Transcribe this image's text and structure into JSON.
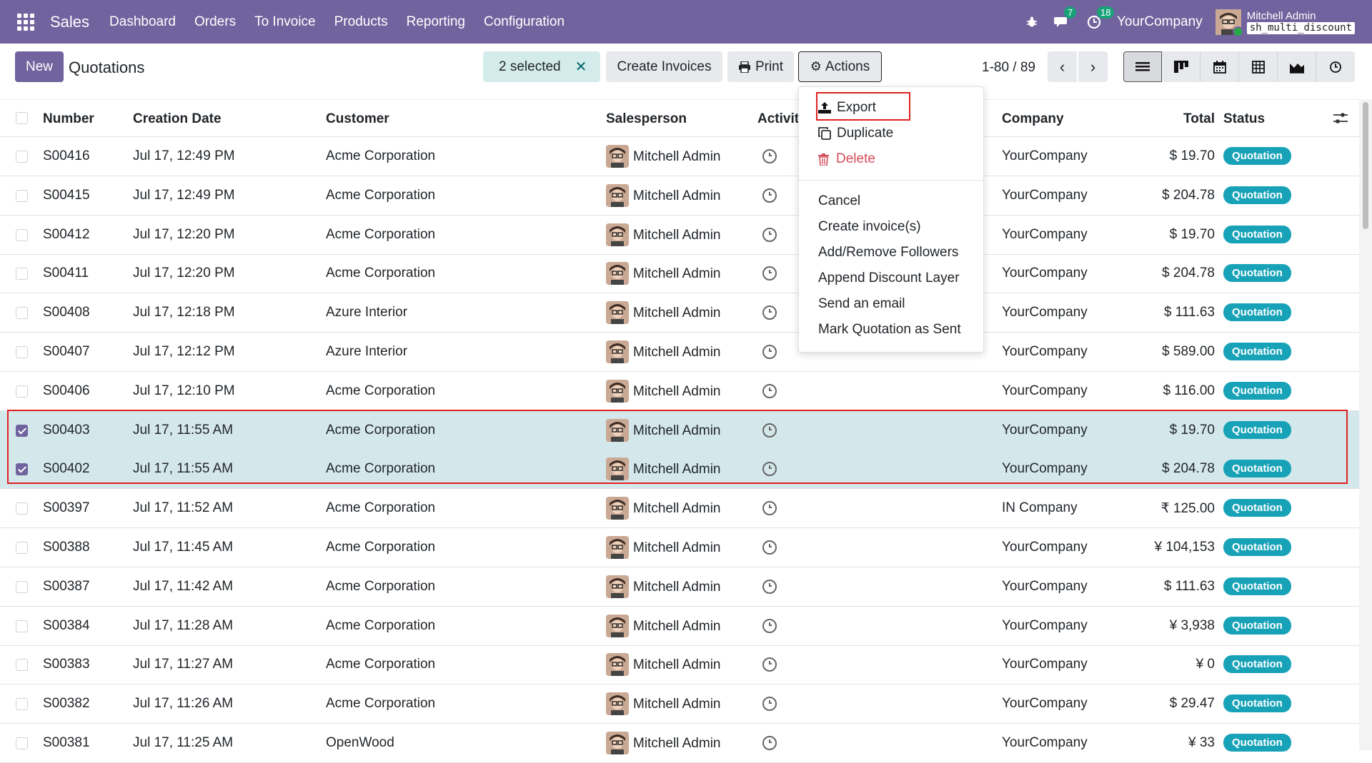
{
  "navbar": {
    "app_name": "Sales",
    "menu": [
      "Dashboard",
      "Orders",
      "To Invoice",
      "Products",
      "Reporting",
      "Configuration"
    ],
    "messages_count": "7",
    "activities_count": "18",
    "company": "YourCompany",
    "user_name": "Mitchell Admin",
    "database": "sh_multi_discount"
  },
  "control_panel": {
    "new_label": "New",
    "title": "Quotations",
    "selected_label": "2 selected",
    "create_invoices_label": "Create Invoices",
    "print_label": "Print",
    "actions_label": "Actions",
    "pager": "1-80 / 89"
  },
  "actions_menu": {
    "items": [
      "Export",
      "Duplicate",
      "Delete",
      "Cancel",
      "Create invoice(s)",
      "Add/Remove Followers",
      "Append Discount Layer",
      "Send an email",
      "Mark Quotation as Sent"
    ]
  },
  "table": {
    "headers": {
      "number": "Number",
      "creation_date": "Creation Date",
      "customer": "Customer",
      "salesperson": "Salesperson",
      "activities": "Activit",
      "company": "Company",
      "total": "Total",
      "status": "Status"
    },
    "rows": [
      {
        "number": "S00416",
        "date": "Jul 17, 12:49 PM",
        "customer": "Acme Corporation",
        "salesperson": "Mitchell Admin",
        "company": "YourCompany",
        "total": "$ 19.70",
        "status": "Quotation",
        "selected": false
      },
      {
        "number": "S00415",
        "date": "Jul 17, 12:49 PM",
        "customer": "Acme Corporation",
        "salesperson": "Mitchell Admin",
        "company": "YourCompany",
        "total": "$ 204.78",
        "status": "Quotation",
        "selected": false
      },
      {
        "number": "S00412",
        "date": "Jul 17, 12:20 PM",
        "customer": "Acme Corporation",
        "salesperson": "Mitchell Admin",
        "company": "YourCompany",
        "total": "$ 19.70",
        "status": "Quotation",
        "selected": false
      },
      {
        "number": "S00411",
        "date": "Jul 17, 12:20 PM",
        "customer": "Acme Corporation",
        "salesperson": "Mitchell Admin",
        "company": "YourCompany",
        "total": "$ 204.78",
        "status": "Quotation",
        "selected": false
      },
      {
        "number": "S00408",
        "date": "Jul 17, 12:18 PM",
        "customer": "Azure Interior",
        "salesperson": "Mitchell Admin",
        "company": "YourCompany",
        "total": "$ 111.63",
        "status": "Quotation",
        "selected": false
      },
      {
        "number": "S00407",
        "date": "Jul 17, 12:12 PM",
        "customer": "Azure Interior",
        "salesperson": "Mitchell Admin",
        "company": "YourCompany",
        "total": "$ 589.00",
        "status": "Quotation",
        "selected": false
      },
      {
        "number": "S00406",
        "date": "Jul 17, 12:10 PM",
        "customer": "Acme Corporation",
        "salesperson": "Mitchell Admin",
        "company": "YourCompany",
        "total": "$ 116.00",
        "status": "Quotation",
        "selected": false
      },
      {
        "number": "S00403",
        "date": "Jul 17, 11:55 AM",
        "customer": "Acme Corporation",
        "salesperson": "Mitchell Admin",
        "company": "YourCompany",
        "total": "$ 19.70",
        "status": "Quotation",
        "selected": true
      },
      {
        "number": "S00402",
        "date": "Jul 17, 11:55 AM",
        "customer": "Acme Corporation",
        "salesperson": "Mitchell Admin",
        "company": "YourCompany",
        "total": "$ 204.78",
        "status": "Quotation",
        "selected": true
      },
      {
        "number": "S00397",
        "date": "Jul 17, 11:52 AM",
        "customer": "Acme Corporation",
        "salesperson": "Mitchell Admin",
        "company": "IN Company",
        "total": "₹ 125.00",
        "status": "Quotation",
        "selected": false
      },
      {
        "number": "S00388",
        "date": "Jul 17, 11:45 AM",
        "customer": "Acme Corporation",
        "salesperson": "Mitchell Admin",
        "company": "YourCompany",
        "total": "¥ 104,153",
        "status": "Quotation",
        "selected": false
      },
      {
        "number": "S00387",
        "date": "Jul 17, 11:42 AM",
        "customer": "Acme Corporation",
        "salesperson": "Mitchell Admin",
        "company": "YourCompany",
        "total": "$ 111.63",
        "status": "Quotation",
        "selected": false
      },
      {
        "number": "S00384",
        "date": "Jul 17, 11:28 AM",
        "customer": "Acme Corporation",
        "salesperson": "Mitchell Admin",
        "company": "YourCompany",
        "total": "¥ 3,938",
        "status": "Quotation",
        "selected": false
      },
      {
        "number": "S00383",
        "date": "Jul 17, 11:27 AM",
        "customer": "Acme Corporation",
        "salesperson": "Mitchell Admin",
        "company": "YourCompany",
        "total": "¥ 0",
        "status": "Quotation",
        "selected": false
      },
      {
        "number": "S00382",
        "date": "Jul 17, 11:26 AM",
        "customer": "Acme Corporation",
        "salesperson": "Mitchell Admin",
        "company": "YourCompany",
        "total": "$ 29.47",
        "status": "Quotation",
        "selected": false
      },
      {
        "number": "S00381",
        "date": "Jul 17, 11:25 AM",
        "customer": "OpenWood",
        "salesperson": "Mitchell Admin",
        "company": "YourCompany",
        "total": "¥ 33",
        "status": "Quotation",
        "selected": false
      }
    ]
  },
  "colors": {
    "brand": "#71639e",
    "status_badge": "#17a2b8",
    "selected_row": "#d4e8ec",
    "highlight_outline": "#e02020",
    "danger": "#d44c59"
  },
  "icons": [
    "apps-icon",
    "bug-icon",
    "chat-icon",
    "clock-icon",
    "close-icon",
    "printer-icon",
    "gear-icon",
    "chevron-left-icon",
    "chevron-right-icon",
    "list-view-icon",
    "kanban-view-icon",
    "calendar-view-icon",
    "pivot-view-icon",
    "graph-view-icon",
    "activity-view-icon",
    "export-icon",
    "duplicate-icon",
    "trash-icon",
    "column-settings-icon"
  ]
}
